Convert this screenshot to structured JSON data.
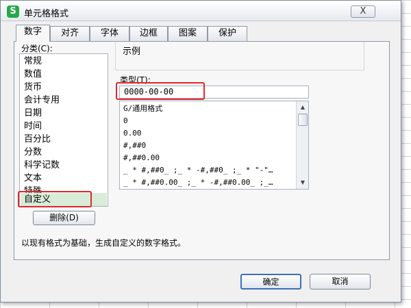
{
  "window": {
    "app_icon": "S",
    "title": "单元格格式",
    "close_label": "X"
  },
  "tabs": [
    {
      "label": "数字",
      "active": true
    },
    {
      "label": "对齐",
      "active": false
    },
    {
      "label": "字体",
      "active": false
    },
    {
      "label": "边框",
      "active": false
    },
    {
      "label": "图案",
      "active": false
    },
    {
      "label": "保护",
      "active": false
    }
  ],
  "category": {
    "label": "分类(C):",
    "items": [
      "常规",
      "数值",
      "货币",
      "会计专用",
      "日期",
      "时间",
      "百分比",
      "分数",
      "科学记数",
      "文本",
      "特殊",
      "自定义"
    ],
    "selected": "自定义"
  },
  "delete_button": "删除(D)",
  "sample": {
    "label": "示例"
  },
  "type": {
    "label": "类型(T):",
    "value": "0000-00-00",
    "formats": [
      "G/通用格式",
      "0",
      "0.00",
      "#,##0",
      "#,##0.00",
      "_ * #,##0_ ;_ * -#,##0_ ;_ * \"-\"…",
      "_ * #,##0.00_ ;_ * -#,##0.00_ ;_…"
    ]
  },
  "description": "以现有格式为基础，生成自定义的数字格式。",
  "footer": {
    "ok_label": "确定",
    "cancel_label": "取消"
  },
  "colors": {
    "highlight": "#e0262b",
    "selection": "#d8ecd8",
    "app_logo": "#26a94a"
  }
}
